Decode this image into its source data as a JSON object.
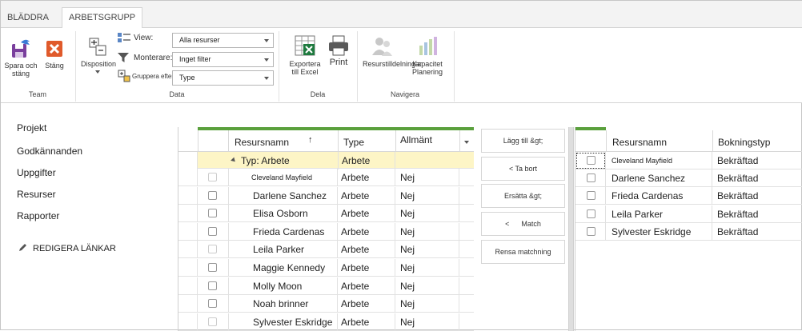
{
  "tabs": [
    "BLÄDDRA",
    "ARBETSGRUPP"
  ],
  "ribbon": {
    "team": {
      "save": "Spara och stäng",
      "close": "Stäng",
      "label": "Team"
    },
    "data": {
      "disposition": "Disposition",
      "view_label": "View:",
      "filter_label": "Monterare:",
      "group_label": "Gruppera efter:",
      "view_value": "Alla resurser",
      "filter_value": "Inget filter",
      "group_value": "Type",
      "label": "Data"
    },
    "share": {
      "export": "Exportera till Excel",
      "print": "Print",
      "label": "Dela"
    },
    "navigate": {
      "assign": "Resurstilldelningar",
      "capacity": "Kapacitet Planering",
      "label": "Navigera"
    }
  },
  "nav": {
    "items": [
      "Projekt",
      "Godkännanden",
      "Uppgifter",
      "Resurser",
      "Rapporter"
    ],
    "edit_links": "REDIGERA LÄNKAR"
  },
  "left_grid": {
    "columns": [
      "Resursnamn",
      "Type",
      "Allmänt"
    ],
    "sort_indicator": "↑",
    "group_row": {
      "label": "Typ: Arbete",
      "type": "Arbete"
    },
    "rows": [
      {
        "name": "Cleveland Mayfield",
        "type": "Arbete",
        "generic": "Nej"
      },
      {
        "name": "Darlene Sanchez",
        "type": "Arbete",
        "generic": "Nej"
      },
      {
        "name": "Elisa Osborn",
        "type": "Arbete",
        "generic": "Nej"
      },
      {
        "name": "Frieda Cardenas",
        "type": "Arbete",
        "generic": "Nej"
      },
      {
        "name": "Leila Parker",
        "type": "Arbete",
        "generic": "Nej"
      },
      {
        "name": "Maggie Kennedy",
        "type": "Arbete",
        "generic": "Nej"
      },
      {
        "name": "Molly Moon",
        "type": "Arbete",
        "generic": "Nej"
      },
      {
        "name": "Noah brinner",
        "type": "Arbete",
        "generic": "Nej"
      },
      {
        "name": "Sylvester Eskridge",
        "type": "Arbete",
        "generic": "Nej"
      }
    ]
  },
  "middle_buttons": {
    "add": "Lägg till &gt;",
    "remove": "< Ta bort",
    "replace": "Ersätta &gt;",
    "match": "<      Match",
    "clear": "Rensa matchning"
  },
  "right_grid": {
    "columns": [
      "Resursnamn",
      "Bokningstyp"
    ],
    "rows": [
      {
        "name": "Cleveland Mayfield",
        "booking": "Bekräftad"
      },
      {
        "name": "Darlene Sanchez",
        "booking": "Bekräftad"
      },
      {
        "name": "Frieda Cardenas",
        "booking": "Bekräftad"
      },
      {
        "name": "Leila Parker",
        "booking": "Bekräftad"
      },
      {
        "name": "Sylvester Eskridge",
        "booking": "Bekräftad"
      }
    ]
  },
  "colors": {
    "accent_green": "#5aa03c",
    "group_row": "#fdf5c6",
    "excel_green": "#1f7a3f",
    "close_red": "#e05a2b",
    "save_purple": "#7a3f9d"
  }
}
